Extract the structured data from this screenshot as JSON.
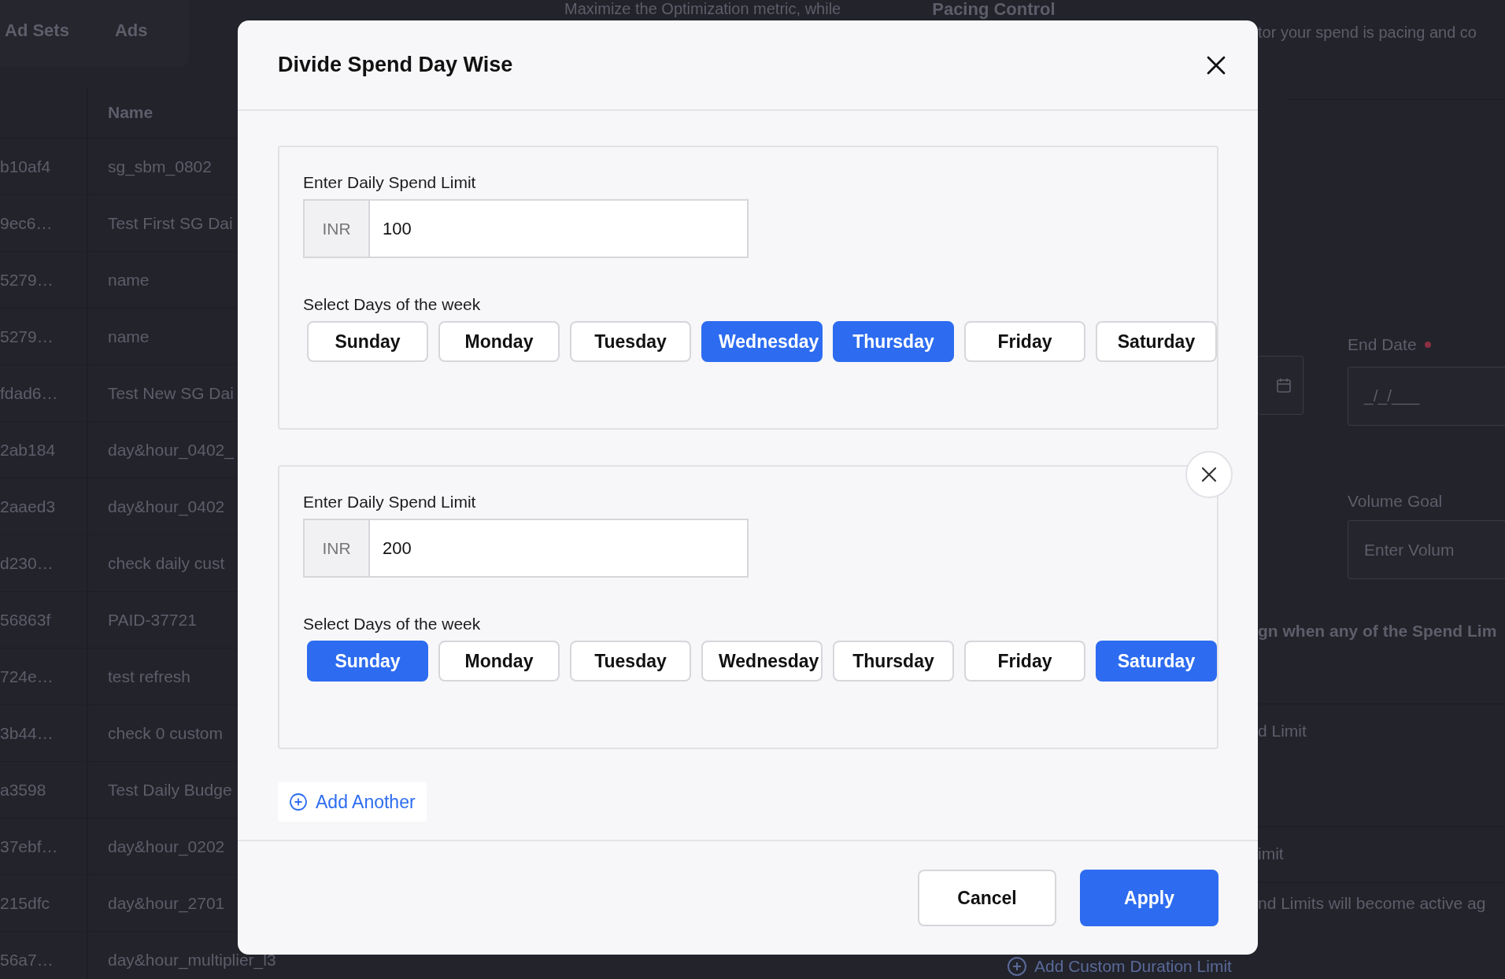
{
  "background": {
    "tabs": [
      {
        "label": "Ad Sets"
      },
      {
        "label": "Ads"
      }
    ],
    "table": {
      "column_2": "Name",
      "rows": [
        {
          "column_1": "b10af4",
          "name": "sg_sbm_0802"
        },
        {
          "column_1": "9ec6…",
          "name": "Test First SG Dai"
        },
        {
          "column_1": "5279…",
          "name": "name"
        },
        {
          "column_1": "5279…",
          "name": "name"
        },
        {
          "column_1": "fdad6…",
          "name": "Test New SG Dai"
        },
        {
          "column_1": "2ab184",
          "name": "day&hour_0402_"
        },
        {
          "column_1": "2aaed3",
          "name": "day&hour_0402"
        },
        {
          "column_1": "d230…",
          "name": "check daily cust"
        },
        {
          "column_1": "56863f",
          "name": "PAID-37721"
        },
        {
          "column_1": "724e…",
          "name": "test refresh"
        },
        {
          "column_1": "3b44…",
          "name": "check 0 custom"
        },
        {
          "column_1": "a3598",
          "name": "Test Daily Budge"
        },
        {
          "column_1": "37ebf…",
          "name": "day&hour_0202"
        },
        {
          "column_1": "215dfc",
          "name": "day&hour_2701"
        },
        {
          "column_1": "56a7…",
          "name": "day&hour_multiplier_l3"
        }
      ]
    },
    "objective_text": "Maximize the Optimization metric, while",
    "pacing_title": "Pacing Control",
    "pacing_text": "tor your spend is pacing and co",
    "end_date": {
      "label": "End Date",
      "required": true,
      "placeholder": "_/_/___"
    },
    "volume_goal": {
      "label": "Volume Goal",
      "placeholder": "Enter Volum"
    },
    "notice": "gn when any of the Spend Lim",
    "limit_rows": [
      "d Limit",
      "imit",
      "nd Limits will become active ag"
    ],
    "add_limit_link": "Add Custom Duration Limit"
  },
  "modal": {
    "title": "Divide Spend Day Wise",
    "sections": [
      {
        "removable": false,
        "limit_label": "Enter Daily Spend Limit",
        "currency": "INR",
        "value": "100",
        "days_label": "Select Days of the week",
        "days": [
          {
            "label": "Sunday",
            "selected": false
          },
          {
            "label": "Monday",
            "selected": false
          },
          {
            "label": "Tuesday",
            "selected": false
          },
          {
            "label": "Wednesday",
            "selected": true
          },
          {
            "label": "Thursday",
            "selected": true
          },
          {
            "label": "Friday",
            "selected": false
          },
          {
            "label": "Saturday",
            "selected": false
          }
        ]
      },
      {
        "removable": true,
        "limit_label": "Enter Daily Spend Limit",
        "currency": "INR",
        "value": "200",
        "days_label": "Select Days of the week",
        "days": [
          {
            "label": "Sunday",
            "selected": true
          },
          {
            "label": "Monday",
            "selected": false
          },
          {
            "label": "Tuesday",
            "selected": false
          },
          {
            "label": "Wednesday",
            "selected": false
          },
          {
            "label": "Thursday",
            "selected": false
          },
          {
            "label": "Friday",
            "selected": false
          },
          {
            "label": "Saturday",
            "selected": true
          }
        ]
      }
    ],
    "add_label": "Add Another",
    "buttons": [
      {
        "label": "Cancel",
        "kind": "secondary"
      },
      {
        "label": "Apply",
        "kind": "primary"
      }
    ]
  }
}
